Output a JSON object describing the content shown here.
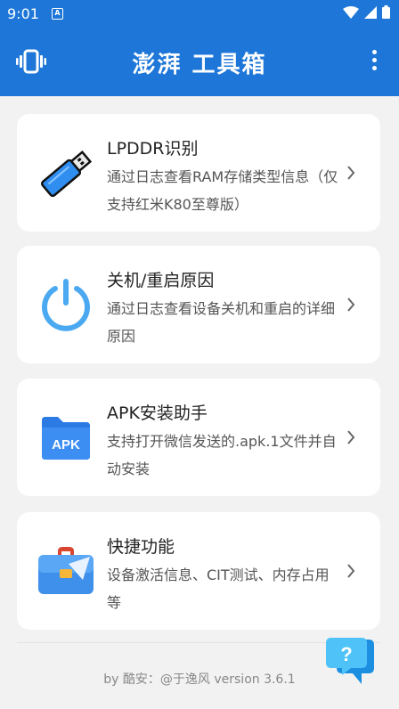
{
  "status_bar": {
    "time": "9:01",
    "notification_icon": "A"
  },
  "app_bar": {
    "title": "澎湃 工具箱"
  },
  "cards": [
    {
      "title": "LPDDR识别",
      "description": "通过日志查看RAM存储类型信息（仅支持红米K80至尊版）",
      "icon": "usb-stick-icon"
    },
    {
      "title": "关机/重启原因",
      "description": "通过日志查看设备关机和重启的详细原因",
      "icon": "power-icon"
    },
    {
      "title": "APK安装助手",
      "description": "支持打开微信发送的.apk.1文件并自动安装",
      "icon": "apk-folder-icon",
      "icon_label": "APK"
    },
    {
      "title": "快捷功能",
      "description": "设备激活信息、CIT测试、内存占用等",
      "icon": "briefcase-icon"
    }
  ],
  "footer": {
    "text": "by 酷安：@于逸风 version 3.6.1"
  },
  "colors": {
    "primary": "#1e77d8",
    "background": "#f2f2f2",
    "card": "#ffffff"
  }
}
